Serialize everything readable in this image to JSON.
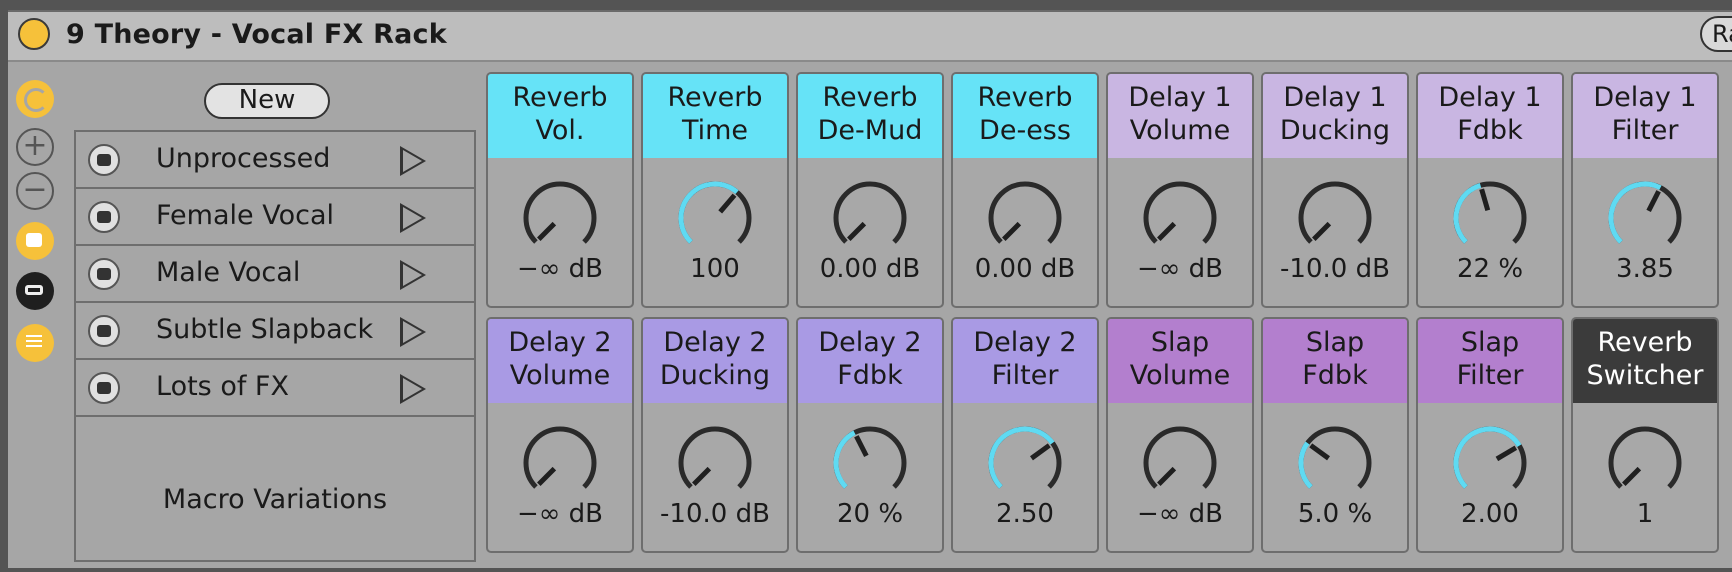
{
  "device": {
    "title": "9 Theory - Vocal FX Rack",
    "right_button_label": "Ra",
    "accent": "#f6c13a"
  },
  "left_buttons": [
    "macro-mapping-icon",
    "plus-icon",
    "minus-icon",
    "camera-icon",
    "mute-icon",
    "list-icon"
  ],
  "variations": {
    "new_label": "New",
    "items": [
      "Unprocessed",
      "Female Vocal",
      "Male Vocal",
      "Subtle Slapback",
      "Lots of FX"
    ],
    "footer": "Macro Variations"
  },
  "colors": {
    "reverb": "#66e3f7",
    "delay1": "#c9b6e2",
    "delay2": "#a99ae4",
    "slap": "#b37fce",
    "switcher": "#3b3b3b",
    "arc": "#5fdaf2"
  },
  "macros": [
    {
      "label": [
        "Reverb",
        "Vol."
      ],
      "value": "−∞ dB",
      "level": 0.0,
      "color": "reverb"
    },
    {
      "label": [
        "Reverb",
        "Time"
      ],
      "value": "100",
      "level": 0.65,
      "color": "reverb"
    },
    {
      "label": [
        "Reverb",
        "De-Mud"
      ],
      "value": "0.00 dB",
      "level": 0.0,
      "color": "reverb"
    },
    {
      "label": [
        "Reverb",
        "De-ess"
      ],
      "value": "0.00 dB",
      "level": 0.0,
      "color": "reverb"
    },
    {
      "label": [
        "Delay 1",
        "Volume"
      ],
      "value": "−∞ dB",
      "level": 0.0,
      "color": "delay1"
    },
    {
      "label": [
        "Delay 1",
        "Ducking"
      ],
      "value": "-10.0 dB",
      "level": 0.0,
      "color": "delay1"
    },
    {
      "label": [
        "Delay 1",
        "Fdbk"
      ],
      "value": "22 %",
      "level": 0.44,
      "color": "delay1"
    },
    {
      "label": [
        "Delay 1",
        "Filter"
      ],
      "value": "3.85",
      "level": 0.6,
      "color": "delay1"
    },
    {
      "label": [
        "Delay 2",
        "Volume"
      ],
      "value": "−∞ dB",
      "level": 0.0,
      "color": "delay2"
    },
    {
      "label": [
        "Delay 2",
        "Ducking"
      ],
      "value": "-10.0 dB",
      "level": 0.0,
      "color": "delay2"
    },
    {
      "label": [
        "Delay 2",
        "Fdbk"
      ],
      "value": "20 %",
      "level": 0.4,
      "color": "delay2"
    },
    {
      "label": [
        "Delay 2",
        "Filter"
      ],
      "value": "2.50",
      "level": 0.7,
      "color": "delay2"
    },
    {
      "label": [
        "Slap",
        "Volume"
      ],
      "value": "−∞ dB",
      "level": 0.0,
      "color": "slap"
    },
    {
      "label": [
        "Slap",
        "Fdbk"
      ],
      "value": "5.0 %",
      "level": 0.3,
      "color": "slap"
    },
    {
      "label": [
        "Slap",
        "Filter"
      ],
      "value": "2.00",
      "level": 0.72,
      "color": "slap"
    },
    {
      "label": [
        "Reverb",
        "Switcher"
      ],
      "value": "1",
      "level": 0.0,
      "color": "switcher"
    }
  ]
}
